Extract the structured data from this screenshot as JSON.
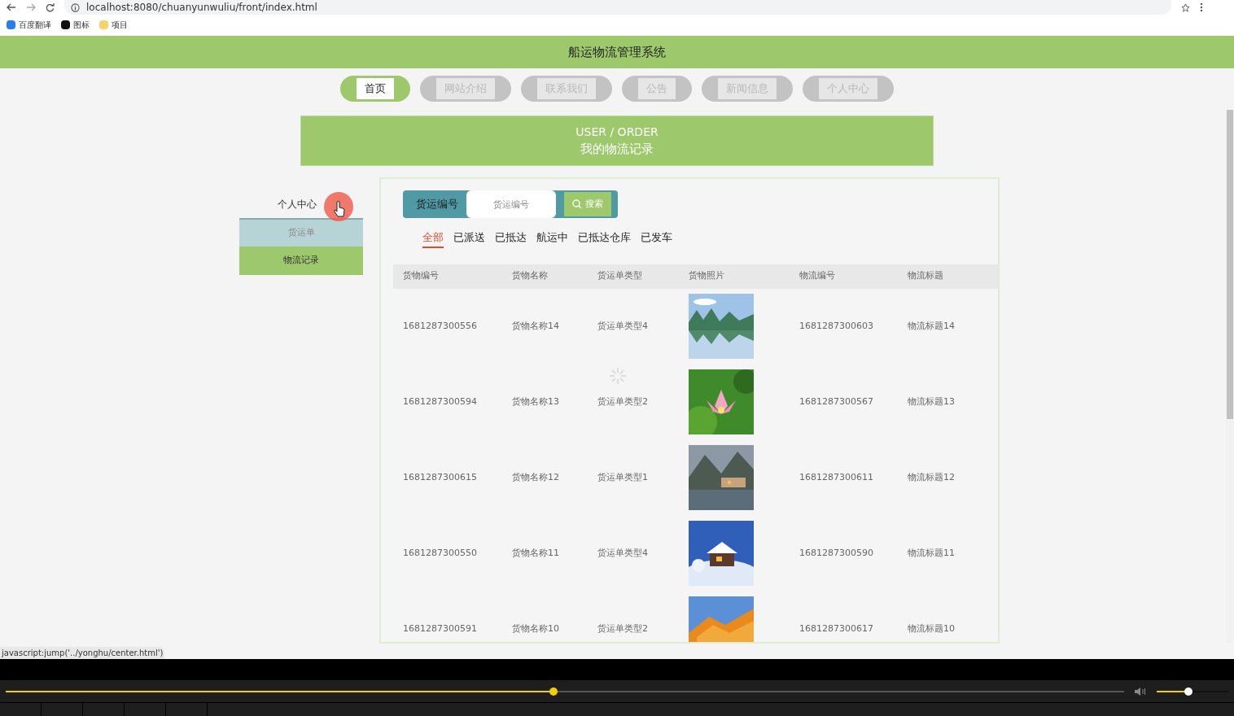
{
  "browser": {
    "url": "localhost:8080/chuanyunwuliu/front/index.html",
    "bookmarks": [
      "百度翻译",
      "图标",
      "项目"
    ]
  },
  "site_title": "船运物流管理系统",
  "nav": [
    {
      "label": "首页",
      "selected": true
    },
    {
      "label": "网站介绍",
      "selected": false
    },
    {
      "label": "联系我们",
      "selected": false
    },
    {
      "label": "公告",
      "selected": false
    },
    {
      "label": "新闻信息",
      "selected": false
    },
    {
      "label": "个人中心",
      "selected": false
    }
  ],
  "banner": {
    "subtitle": "USER / ORDER",
    "title": "我的物流记录"
  },
  "sidebar": {
    "title": "个人中心",
    "items": [
      {
        "label": "货运单",
        "selected": false,
        "hovered": true
      },
      {
        "label": "物流记录",
        "selected": true,
        "hovered": false
      }
    ]
  },
  "search": {
    "label": "货运编号",
    "placeholder": "货运编号",
    "button": "搜索"
  },
  "filters": [
    {
      "label": "全部",
      "selected": true
    },
    {
      "label": "已派送",
      "selected": false
    },
    {
      "label": "已抵达",
      "selected": false
    },
    {
      "label": "航运中",
      "selected": false
    },
    {
      "label": "已抵达仓库",
      "selected": false
    },
    {
      "label": "已发车",
      "selected": false
    }
  ],
  "table": {
    "columns": [
      "货物编号",
      "货物名称",
      "货运单类型",
      "货物照片",
      "物流编号",
      "物流标题"
    ],
    "rows": [
      {
        "cells": [
          "1681287300556",
          "货物名称14",
          "货运单类型4",
          "",
          "1681287300603",
          "物流标题14"
        ]
      },
      {
        "cells": [
          "1681287300594",
          "货物名称13",
          "货运单类型2",
          "",
          "1681287300567",
          "物流标题13"
        ]
      },
      {
        "cells": [
          "1681287300615",
          "货物名称12",
          "货运单类型1",
          "",
          "1681287300611",
          "物流标题12"
        ]
      },
      {
        "cells": [
          "1681287300550",
          "货物名称11",
          "货运单类型4",
          "",
          "1681287300590",
          "物流标题11"
        ]
      },
      {
        "cells": [
          "1681287300591",
          "货物名称10",
          "货运单类型2",
          "",
          "1681287300617",
          "物流标题10"
        ]
      }
    ]
  },
  "status_link": "javascript:jump('../yonghu/center.html')",
  "player": {
    "progress": {
      "level": 0.49
    },
    "volume": {
      "level": 0.44
    }
  }
}
